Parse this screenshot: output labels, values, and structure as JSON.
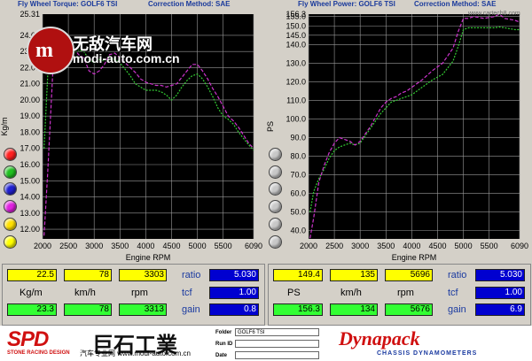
{
  "watermark": {
    "brand_cn": "无敌汽车网",
    "site": "modi-auto.com.cn",
    "corner_url": "www.cartech8.com",
    "bottom_url": "汽车专业网 www.modi-auto.com.cn"
  },
  "charts": {
    "torque": {
      "title_left": "Fly Wheel Torque: GOLF6 TSI",
      "title_right": "Correction Method: SAE",
      "top_label": "25.31",
      "ylabel": "Kg/m",
      "xlabel": "Engine RPM"
    },
    "power": {
      "title_left": "Fly Wheel Power: GOLF6 TSI",
      "title_right": "Correction Method: SAE",
      "top_label": "156.3",
      "ylabel": "PS",
      "xlabel": "Engine RPM"
    }
  },
  "chart_data": [
    {
      "type": "line",
      "title": "Fly Wheel Torque: GOLF6 TSI",
      "xlabel": "Engine RPM",
      "ylabel": "Kg/m",
      "xlim": [
        2000,
        6090
      ],
      "ylim": [
        11.4,
        25.31
      ],
      "x_ticks": [
        2000,
        2500,
        3000,
        3500,
        4000,
        4500,
        5000,
        5500,
        6090
      ],
      "y_ticks": [
        12.0,
        13.0,
        14.0,
        15.0,
        16.0,
        17.0,
        18.0,
        19.0,
        20.0,
        21.0,
        22.0,
        23.0,
        24.0
      ],
      "grid": true,
      "series": [
        {
          "color": "#33cc33",
          "x": [
            2030,
            2100,
            2200,
            2300,
            2400,
            2500,
            2600,
            2700,
            2800,
            2900,
            3000,
            3100,
            3200,
            3300,
            3400,
            3500,
            3600,
            3700,
            3800,
            3900,
            4000,
            4100,
            4200,
            4300,
            4400,
            4500,
            4600,
            4700,
            4800,
            4900,
            5000,
            5100,
            5200,
            5300,
            5400,
            5500,
            5600,
            5700,
            5800,
            5900,
            6000,
            6090
          ],
          "values": [
            17.0,
            21.5,
            23.2,
            23.1,
            23.0,
            23.0,
            22.9,
            23.1,
            23.0,
            22.5,
            22.3,
            22.5,
            22.4,
            22.6,
            22.5,
            22.3,
            21.9,
            21.5,
            21.0,
            20.8,
            20.6,
            20.6,
            20.6,
            20.5,
            20.3,
            20.0,
            20.3,
            20.8,
            21.2,
            21.5,
            21.6,
            21.3,
            20.8,
            20.2,
            19.5,
            19.0,
            18.8,
            18.5,
            18.0,
            17.6,
            17.2,
            16.9
          ]
        },
        {
          "color": "#cc33cc",
          "x": [
            2030,
            2100,
            2200,
            2300,
            2400,
            2500,
            2600,
            2700,
            2800,
            2900,
            3000,
            3100,
            3200,
            3300,
            3400,
            3500,
            3600,
            3700,
            3800,
            3900,
            4000,
            4100,
            4200,
            4300,
            4400,
            4500,
            4600,
            4700,
            4800,
            4900,
            5000,
            5100,
            5200,
            5300,
            5400,
            5500,
            5600,
            5700,
            5800,
            5900,
            6000,
            6090
          ],
          "values": [
            11.6,
            15.5,
            21.8,
            23.6,
            24.1,
            23.9,
            23.2,
            22.8,
            22.6,
            21.8,
            21.6,
            21.8,
            22.2,
            22.8,
            22.9,
            22.6,
            22.3,
            22.0,
            21.7,
            21.3,
            21.1,
            21.0,
            20.9,
            20.9,
            20.8,
            20.9,
            21.0,
            21.4,
            21.8,
            22.2,
            22.2,
            21.8,
            21.3,
            20.7,
            20.2,
            19.6,
            19.0,
            18.7,
            18.3,
            17.8,
            17.3,
            17.0
          ]
        }
      ]
    },
    {
      "type": "line",
      "title": "Fly Wheel Power: GOLF6 TSI",
      "xlabel": "Engine RPM",
      "ylabel": "PS",
      "xlim": [
        2000,
        6090
      ],
      "ylim": [
        35.6,
        156.3
      ],
      "x_ticks": [
        2000,
        2500,
        3000,
        3500,
        4000,
        4500,
        5000,
        5500,
        6090
      ],
      "y_ticks": [
        40.0,
        50.0,
        60.0,
        70.0,
        80.0,
        90.0,
        100.0,
        110.0,
        120.0,
        130.0,
        140.0,
        145.0,
        150.0,
        155.0
      ],
      "y_tick_labels": [
        "40.0",
        "50.0",
        "60.0",
        "70.0",
        "80.0",
        "90.0",
        "100.0",
        "110.0",
        "120.0",
        "130.0",
        "140.0",
        "145.0",
        "150.0",
        "155.0"
      ],
      "grid": true,
      "series": [
        {
          "color": "#33cc33",
          "x": [
            2030,
            2100,
            2200,
            2300,
            2400,
            2500,
            2600,
            2700,
            2800,
            2900,
            3000,
            3100,
            3200,
            3300,
            3400,
            3500,
            3600,
            3700,
            3800,
            3900,
            4000,
            4200,
            4400,
            4600,
            4800,
            4900,
            5000,
            5100,
            5200,
            5400,
            5600,
            5700,
            5800,
            6000,
            6090
          ],
          "values": [
            50,
            61,
            68,
            73,
            79,
            83,
            85,
            86,
            87,
            86,
            87,
            91,
            95,
            99,
            103,
            106,
            109,
            110,
            111,
            112,
            113,
            117,
            121,
            124,
            131,
            139,
            148,
            149,
            149,
            149,
            149,
            149.4,
            149,
            148,
            148
          ]
        },
        {
          "color": "#cc33cc",
          "x": [
            2030,
            2100,
            2200,
            2300,
            2400,
            2500,
            2600,
            2700,
            2800,
            2900,
            3000,
            3100,
            3200,
            3300,
            3400,
            3500,
            3600,
            3700,
            3800,
            3900,
            4000,
            4200,
            4400,
            4600,
            4800,
            4900,
            5000,
            5100,
            5200,
            5400,
            5600,
            5700,
            5800,
            6000,
            6090
          ],
          "values": [
            36,
            47,
            66,
            75,
            82,
            87,
            90,
            89,
            88,
            86,
            88,
            92,
            96,
            101,
            106,
            109,
            111,
            112,
            114,
            115,
            117,
            121,
            126,
            130,
            138,
            147,
            154,
            154,
            155,
            154,
            155,
            156.3,
            154,
            153,
            152
          ]
        }
      ]
    }
  ],
  "readouts": {
    "torque": {
      "row1": [
        "22.5",
        "78",
        "3303"
      ],
      "units": [
        "Kg/m",
        "km/h",
        "rpm"
      ],
      "row2": [
        "23.3",
        "78",
        "3313"
      ],
      "ratio_label": "ratio",
      "ratio": "5.030",
      "tcf_label": "tcf",
      "tcf": "1.00",
      "gain_label": "gain",
      "gain": "0.8"
    },
    "power": {
      "row1": [
        "149.4",
        "135",
        "5696"
      ],
      "units": [
        "PS",
        "km/h",
        "rpm"
      ],
      "row2": [
        "156.3",
        "134",
        "5676"
      ],
      "ratio_label": "ratio",
      "ratio": "5.030",
      "tcf_label": "tcf",
      "tcf": "1.00",
      "gain_label": "gain",
      "gain": "6.9"
    }
  },
  "footer": {
    "spd": "SPD",
    "cn_company": "巨石工業",
    "spd_sub": "STONE RACING DESIGN",
    "folder_label": "Folder",
    "folder_value": "GOLF6 TSI",
    "runid_label": "Run ID",
    "date_label": "Date",
    "dynapack": "Dynapack",
    "dynapack_sub": "CHASSIS DYNAMOMETERS"
  },
  "colors": {
    "plot_bg": "#000000",
    "grid": "#9a9a9a",
    "green_series": "#33cc33",
    "magenta_series": "#cc33cc",
    "axis_text": "#ffffff",
    "title_text": "#1a3a9c",
    "readout_yellow": "#ffff00",
    "readout_green": "#33ff33",
    "readout_blue": "#0000d0"
  },
  "selector_dots": {
    "colors": [
      "#ff2020",
      "#20c020",
      "#2020d0",
      "#e020e0",
      "#ffff00"
    ]
  }
}
